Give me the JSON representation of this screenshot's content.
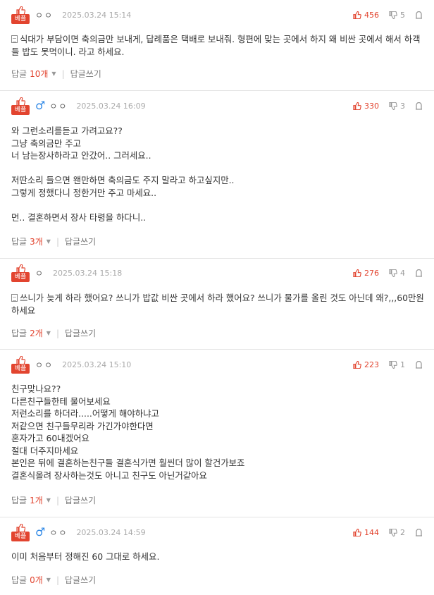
{
  "comments": [
    {
      "badge": "베플",
      "has_gender_icon": false,
      "nick": "ㅇㅇ",
      "date": "2025.03.24 15:14",
      "likes": "456",
      "dislikes": "5",
      "has_doc_icon": true,
      "body": "식대가 부담이면 축의금만 보내게, 답례품은 택배로 보내줘. 형편에 맞는 곳에서 하지 왜 비싼 곳에서 해서 하객들 밥도 못먹이니. 라고 하세요.",
      "reply_label": "답글",
      "reply_count": "10개",
      "write_reply": "답글쓰기"
    },
    {
      "badge": "베플",
      "has_gender_icon": true,
      "gender_icon": "♂",
      "nick": "ㅇㅇ",
      "date": "2025.03.24 16:09",
      "likes": "330",
      "dislikes": "3",
      "has_doc_icon": false,
      "body": "와 그런소리를듣고 가려고요??\n그냥 축의금만 주고\n너 남는장사하라고 안갔어.. 그러세요..\n\n저딴소리 들으면 왠만하면 축의금도 주지 말라고 하고싶지만..\n그렇게 정했다니 정한거만 주고 마세요..\n\n먼.. 결혼하면서 장사 타령을 하다니..",
      "reply_label": "답글",
      "reply_count": "3개",
      "write_reply": "답글쓰기"
    },
    {
      "badge": "베플",
      "has_gender_icon": false,
      "nick": "ㅇ",
      "date": "2025.03.24 15:18",
      "likes": "276",
      "dislikes": "4",
      "has_doc_icon": true,
      "body": "쓰니가 늦게 하라 했어요? 쓰니가 밥값 비싼 곳에서 하라 했어요? 쓰니가 물가를 올린 것도 아닌데 왜?,,,60만원 하세요",
      "reply_label": "답글",
      "reply_count": "2개",
      "write_reply": "답글쓰기"
    },
    {
      "badge": "베플",
      "has_gender_icon": false,
      "nick": "ㅇㅇ",
      "date": "2025.03.24 15:10",
      "likes": "223",
      "dislikes": "1",
      "has_doc_icon": false,
      "body": "친구맞나요??\n다른친구들한테 물어보세요\n저런소리를 하더라.....어떻게 해야하냐고\n저같으면 친구들무리라 가긴가야한다면\n혼자가고 60내겠어요\n절대 더주지마세요\n본인은 뒤에 결혼하는친구들 결혼식가면 훨씬더 많이 할건가보죠\n결혼식올려 장사하는것도 아니고 친구도 아닌거같아요",
      "reply_label": "답글",
      "reply_count": "1개",
      "write_reply": "답글쓰기"
    },
    {
      "badge": "베플",
      "has_gender_icon": true,
      "gender_icon": "♂",
      "nick": "ㅇㅇ",
      "date": "2025.03.24 14:59",
      "likes": "144",
      "dislikes": "2",
      "has_doc_icon": false,
      "body": "이미 처음부터 정해진 60 그대로 하세요.",
      "reply_label": "답글",
      "reply_count": "0개",
      "write_reply": "답글쓰기"
    }
  ],
  "colors": {
    "accent": "#e2442f",
    "gender": "#2f88e6",
    "muted": "#999999"
  },
  "icons": {
    "like": "thumb-up-icon",
    "dislike": "thumb-down-icon",
    "report": "report-icon",
    "doc": "document-icon",
    "gender": "male-icon"
  }
}
